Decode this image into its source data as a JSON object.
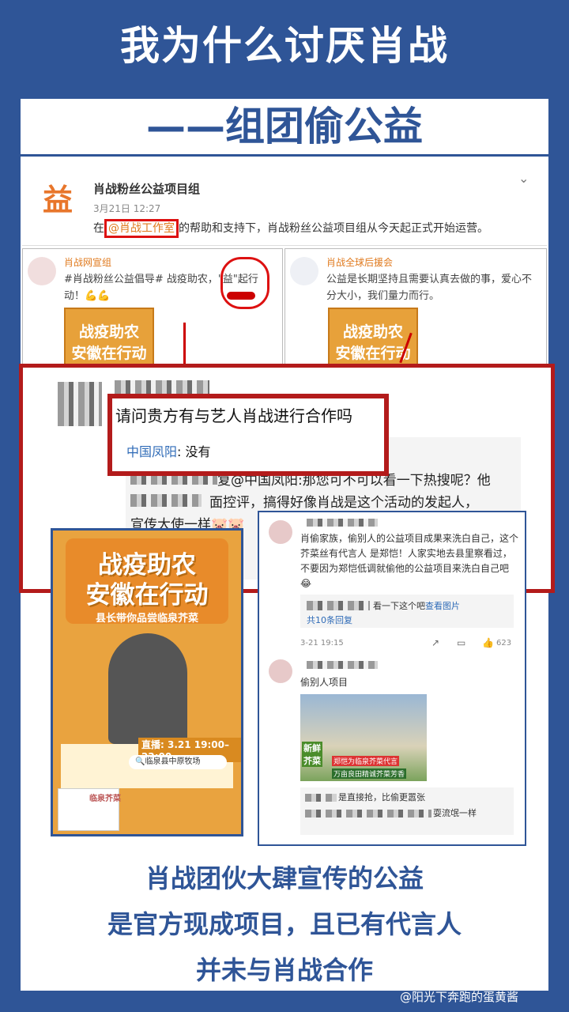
{
  "title": "我为什么讨厌肖战",
  "subtitle": "——组团偷公益",
  "post": {
    "logo": "益",
    "name": "肖战粉丝公益项目组",
    "time": "3月21日 12:27",
    "body_prefix": "在",
    "mention": "@肖战工作室",
    "body_suffix": "的帮助和支持下，肖战粉丝公益项目组从今天起正式开始运营。"
  },
  "card_left": {
    "name": "肖战网宣组",
    "text": "#肖战粉丝公益倡导# 战疫助农，\"益\"起行动！💪💪",
    "poster_line1": "战疫助农",
    "poster_line2": "安徽在行动"
  },
  "card_right": {
    "name": "肖战全球后援会",
    "text": "公益是长期坚持且需要认真去做的事，爱心不分大小，我们量力而行。",
    "poster_line1": "战疫助农",
    "poster_line2": "安徽在行动"
  },
  "chat": {
    "question": "请问贵方有与艺人肖战进行合作吗",
    "reply_name": "中国凤阳",
    "reply_text": ": 没有",
    "followup_line1": "复@中国凤阳:那您可不可以看一下热搜呢？他",
    "followup_line2": "面控评，搞得好像肖战是这个活动的发起人，",
    "followup_line3": "宣传大使一样🐷🐷"
  },
  "poster": {
    "line1": "战疫助农",
    "line2": "安徽在行动",
    "line3": "县长带你品尝临泉芥菜",
    "live": "直播: 3.21  19:00–22:00",
    "search": "临泉县中原牧场",
    "product": "临泉芥菜"
  },
  "comments": {
    "c1_text": "肖偷家族，偷别人的公益项目成果来洗白自己，这个芥菜丝有代言人 是郑恺！人家实地去县里察看过，不要因为郑恺低调就偷他的公益项目来洗白自己吧😂",
    "c1_link": "看一下这个吧",
    "c1_pic": "查看图片",
    "c1_replies": "共10条回复",
    "c1_date": "3-21 19:15",
    "c1_likes": "623",
    "c2_text": "偷别人项目",
    "photo_label1": "新鲜",
    "photo_label2": "芥菜",
    "photo_banner1": "郑恺为临泉芥菜代言",
    "photo_banner2": "万亩良田精诚芥菜芳香",
    "c2_reply1": "是直接抢，比偷更嚣张",
    "c2_reply2": "耍流氓一样"
  },
  "bottom": {
    "line1": "肖战团伙大肆宣传的公益",
    "line2": "是官方现成项目，且已有代言人",
    "line3": "并未与肖战合作"
  },
  "watermark": "@阳光下奔跑的蛋黄酱"
}
